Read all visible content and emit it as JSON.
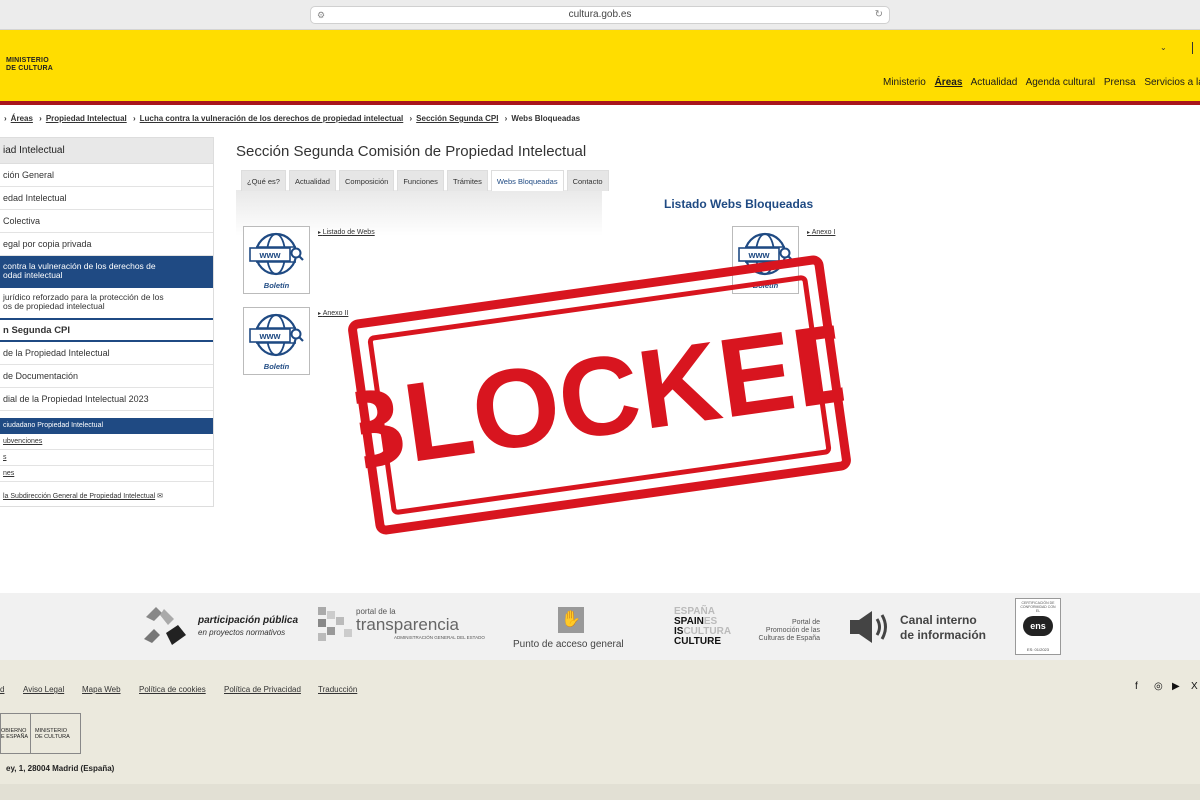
{
  "browser": {
    "url": "cultura.gob.es"
  },
  "header": {
    "logo_line1": "MINISTERIO",
    "logo_line2": "DE CULTURA",
    "nav": [
      "Ministerio",
      "Áreas",
      "Actualidad",
      "Agenda cultural",
      "Prensa",
      "Servicios a la ci"
    ],
    "active_nav": "Áreas",
    "brand_color": "#ffdd00",
    "accent_color": "#a8151c"
  },
  "breadcrumb": [
    "Áreas",
    "Propiedad Intelectual",
    "Lucha contra la vulneración de los derechos de propiedad intelectual",
    "Sección Segunda CPI",
    "Webs Bloqueadas"
  ],
  "sidebar": {
    "head": "iad Intelectual",
    "items": [
      "ción General",
      "edad Intelectual",
      "Colectiva",
      "egal por copia privada"
    ],
    "active": "contra la vulneración de los derechos de\nodad intelectual",
    "sub": "jurídico reforzado para la protección de los\nos de propiedad intelectual",
    "section": "n Segunda CPI",
    "items2": [
      "de la Propiedad Intelectual",
      "de Documentación",
      "dial de la Propiedad Intelectual 2023"
    ],
    "active2": "ciudadano Propiedad Intelectual",
    "small_items": [
      "ubvenciones",
      "s",
      "nes"
    ],
    "mail_link": "la Subdirección General de Propiedad Intelectual",
    "active_color": "#1f4a83"
  },
  "main": {
    "title": "Sección Segunda Comisión de Propiedad Intelectual",
    "tabs": [
      "¿Qué es?",
      "Actualidad",
      "Composición",
      "Funciones",
      "Trámites",
      "Webs Bloqueadas",
      "Contacto"
    ],
    "active_tab": "Webs Bloqueadas",
    "listado_title": "Listado Webs Bloqueadas",
    "cards": [
      {
        "caption": "Boletín",
        "link": "Listado de Webs"
      },
      {
        "caption": "Boletín",
        "link": "Anexo II"
      },
      {
        "caption": "Boletín",
        "link": "Anexo I"
      }
    ],
    "www_label": "www",
    "stamp_text": "BLOCKED",
    "stamp_color": "#d8151f"
  },
  "footer_logos": {
    "participacion_1": "participación pública",
    "participacion_2": "en proyectos normativos",
    "transparencia_1": "portal de la",
    "transparencia_2": "transparencia",
    "transparencia_3": "ADMINISTRACIÓN GENERAL DEL ESTADO",
    "punto": "Punto de acceso general",
    "spain_1": "ESPAÑA",
    "spain_2": "SPAIN",
    "spain_3": "ES",
    "spain_4": "IS",
    "spain_5": "CULTURA",
    "spain_6": "CULTURE",
    "portal_cultura": "Portal de\nPromoción de las\nCulturas de España",
    "canal_1": "Canal interno",
    "canal_2": "de información",
    "ens_label": "ens",
    "ens_header": "CERTIFICACIÓN DE CONFORMIDAD CON EL",
    "ens_code": "ES: 01/2023"
  },
  "footer_links": [
    "d",
    "Aviso Legal",
    "Mapa Web",
    "Política de cookies",
    "Política de Privacidad",
    "Traducción"
  ],
  "footer_gov": {
    "left": "OBIERNO\nE ESPAÑA",
    "right": "MINISTERIO\nDE CULTURA"
  },
  "address": "ey, 1, 28004 Madrid (España)"
}
